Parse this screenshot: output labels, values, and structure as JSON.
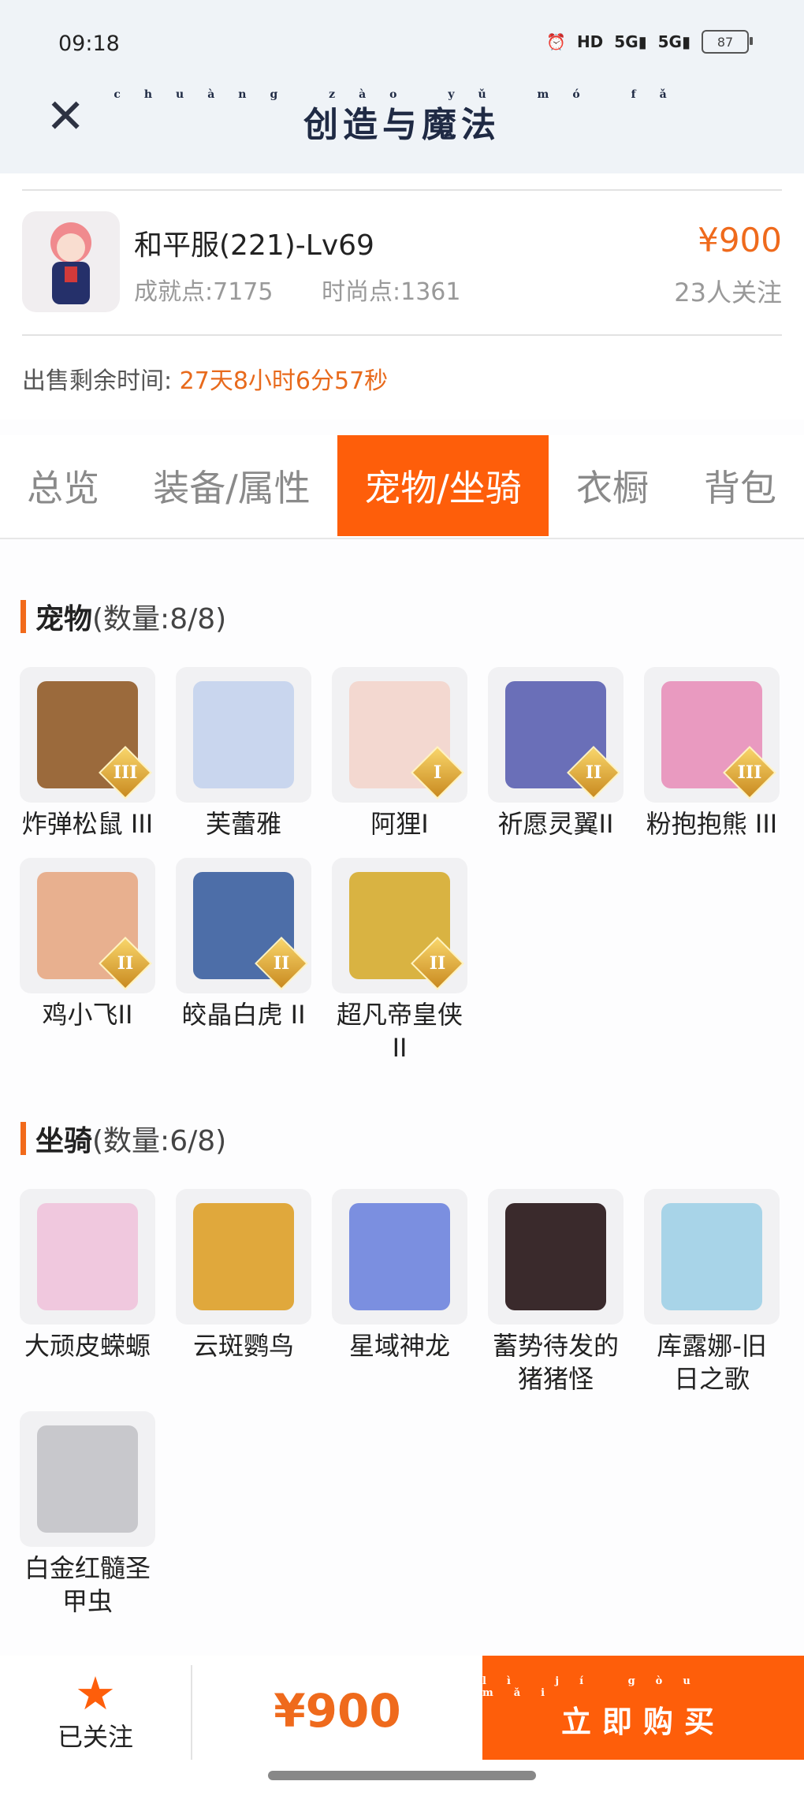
{
  "status_bar": {
    "time": "09:18",
    "battery": "87",
    "hd": "HD",
    "signal1": "5G",
    "signal2": "5G"
  },
  "header": {
    "title": "创造与魔法",
    "title_pinyin": "chuàng zào yǔ mó fǎ"
  },
  "listing": {
    "server": "和平服(221)-Lv69",
    "achievement": "成就点:7175",
    "fashion": "时尚点:1361",
    "price": "¥900",
    "followers": "23人关注",
    "sale_label": "出售剩余时间:",
    "sale_time": "27天8小时6分57秒"
  },
  "tabs": [
    {
      "label": "总览",
      "active": false
    },
    {
      "label": "装备/属性",
      "active": false
    },
    {
      "label": "宠物/坐骑",
      "active": true
    },
    {
      "label": "衣橱",
      "active": false
    },
    {
      "label": "背包",
      "active": false
    }
  ],
  "pets": {
    "title": "宠物",
    "count": "(数量:8/8)",
    "items": [
      {
        "name": "炸弹松鼠 III",
        "badge": "III",
        "color": "#9b6a3c"
      },
      {
        "name": "芙蕾雅",
        "badge": "",
        "color": "#c9d6ee"
      },
      {
        "name": "阿狸I",
        "badge": "I",
        "color": "#f3d8d0"
      },
      {
        "name": "祈愿灵翼II",
        "badge": "II",
        "color": "#6a6fb8"
      },
      {
        "name": "粉抱抱熊 III",
        "badge": "III",
        "color": "#e99ac0"
      },
      {
        "name": "鸡小飞II",
        "badge": "II",
        "color": "#e8b08f"
      },
      {
        "name": "皎晶白虎 II",
        "badge": "II",
        "color": "#4d6ea8"
      },
      {
        "name": "超凡帝皇侠II",
        "badge": "II",
        "color": "#d9b342"
      }
    ]
  },
  "mounts": {
    "title": "坐骑",
    "count": "(数量:6/8)",
    "items": [
      {
        "name": "大顽皮蝾螈",
        "color": "#f0c8de"
      },
      {
        "name": "云斑鹦鸟",
        "color": "#e0a83c"
      },
      {
        "name": "星域神龙",
        "color": "#7b8fe0"
      },
      {
        "name": "蓄势待发的猪猪怪",
        "color": "#3a2a2c"
      },
      {
        "name": "库露娜-旧日之歌",
        "color": "#a8d4e8"
      },
      {
        "name": "白金红髓圣甲虫",
        "color": "#c8c8cc"
      }
    ]
  },
  "bottom_bar": {
    "follow_label": "已关注",
    "price": "¥900",
    "buy_label": "立即购买",
    "buy_pinyin": "lì jí gòu mǎi"
  },
  "colors": {
    "accent": "#fe5e0a",
    "price": "#ef6a1c"
  }
}
